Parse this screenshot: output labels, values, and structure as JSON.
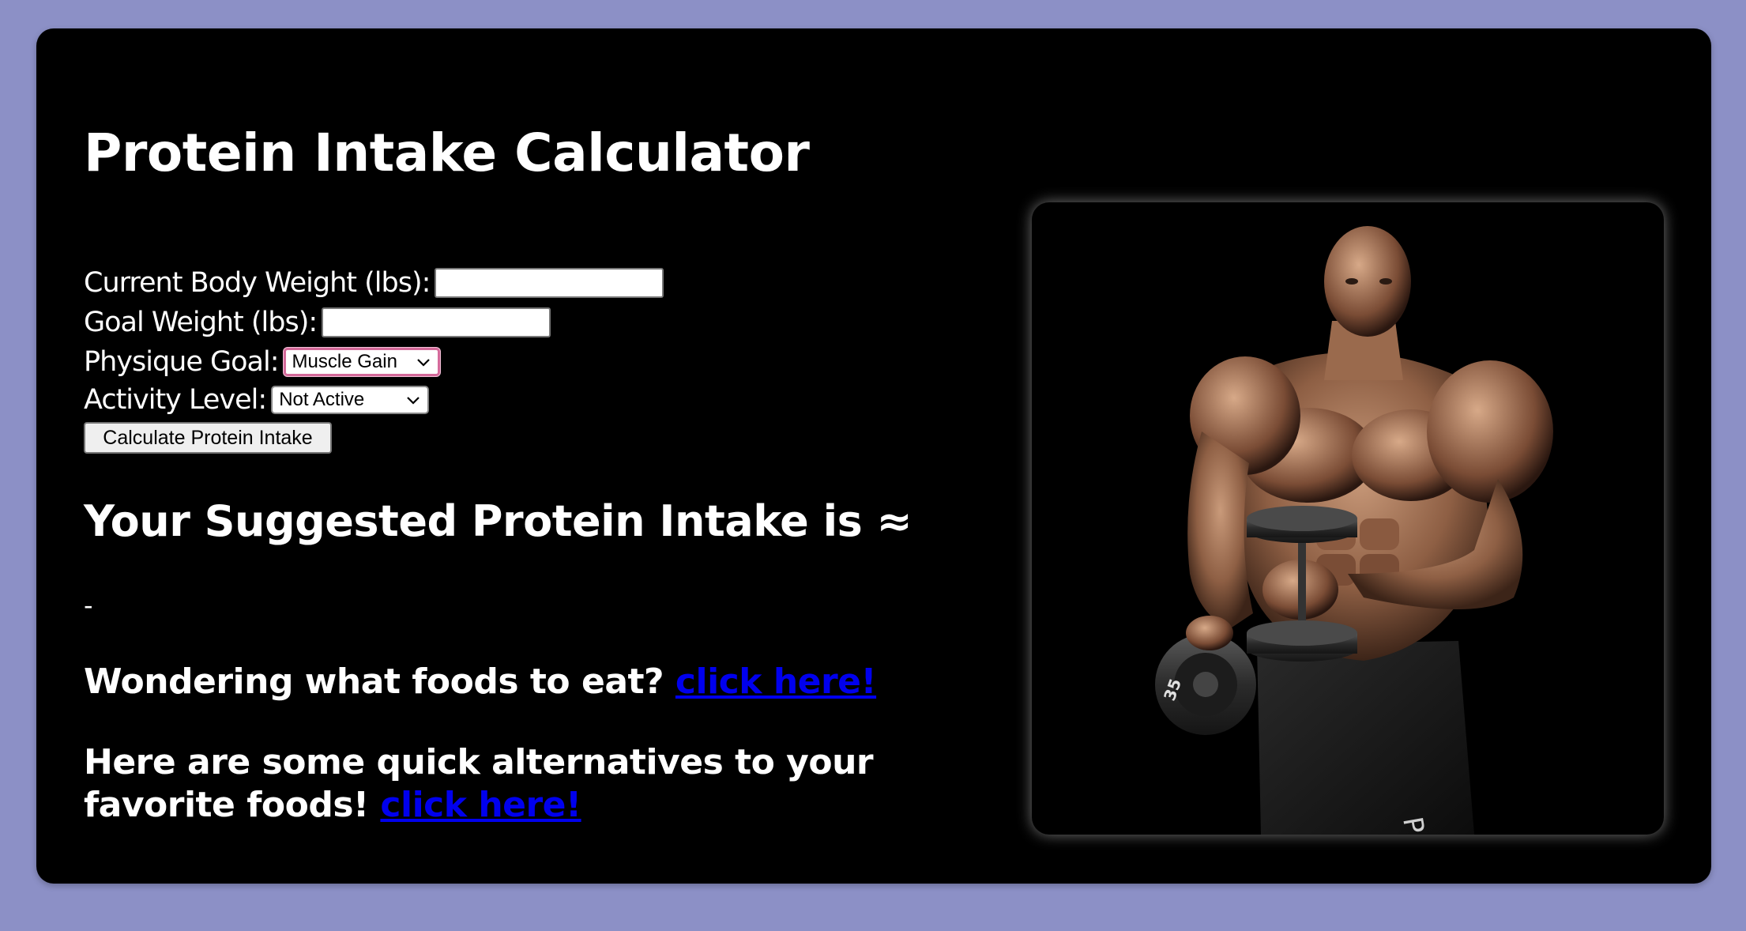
{
  "page": {
    "title": "Protein Intake Calculator"
  },
  "form": {
    "current_weight_label": "Current Body Weight (lbs):",
    "current_weight_value": "",
    "goal_weight_label": "Goal Weight (lbs):",
    "goal_weight_value": "",
    "physique_goal_label": "Physique Goal:",
    "physique_goal_selected": "Muscle Gain",
    "activity_level_label": "Activity Level:",
    "activity_level_selected": "Not Active",
    "calculate_button_label": "Calculate Protein Intake"
  },
  "result": {
    "heading": "Your Suggested Protein Intake is ≈",
    "value": "-"
  },
  "links": {
    "foods_prompt": "Wondering what foods to eat?",
    "foods_link_text": "click here!",
    "alternatives_prompt": "Here are some quick alternatives to your favorite foods!",
    "alternatives_link_text": "click here!"
  },
  "image": {
    "description": "bodybuilder-with-dumbbells",
    "dumbbell_plate_label": "35",
    "shorts_text": "P INC"
  },
  "colors": {
    "page_background": "#8c90c6",
    "card_background": "#000000",
    "text": "#ffffff",
    "link": "#0000ee",
    "focus_ring": "#d46a9a"
  },
  "icons": {
    "select_arrow": "chevron-down-icon"
  }
}
